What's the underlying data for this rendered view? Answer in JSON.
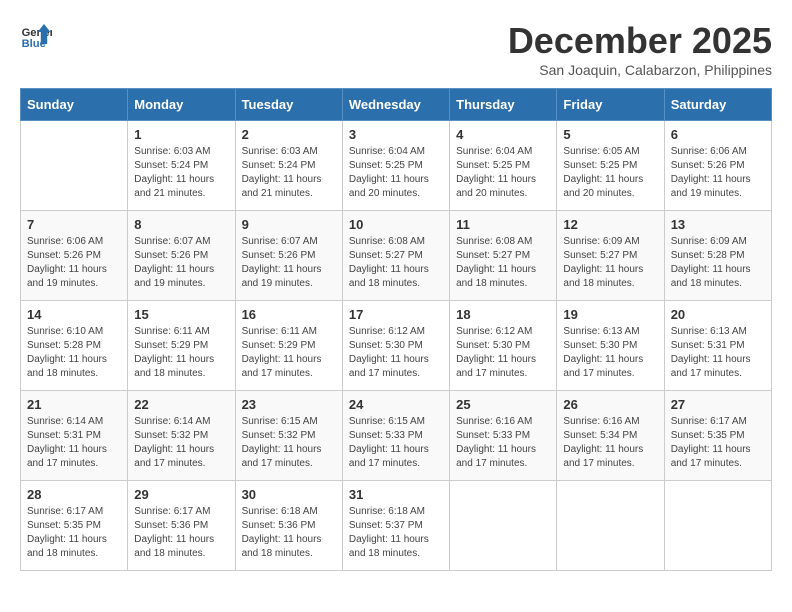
{
  "header": {
    "logo_line1": "General",
    "logo_line2": "Blue",
    "month": "December 2025",
    "location": "San Joaquin, Calabarzon, Philippines"
  },
  "weekdays": [
    "Sunday",
    "Monday",
    "Tuesday",
    "Wednesday",
    "Thursday",
    "Friday",
    "Saturday"
  ],
  "weeks": [
    [
      {
        "day": "",
        "sunrise": "",
        "sunset": "",
        "daylight": ""
      },
      {
        "day": "1",
        "sunrise": "Sunrise: 6:03 AM",
        "sunset": "Sunset: 5:24 PM",
        "daylight": "Daylight: 11 hours and 21 minutes."
      },
      {
        "day": "2",
        "sunrise": "Sunrise: 6:03 AM",
        "sunset": "Sunset: 5:24 PM",
        "daylight": "Daylight: 11 hours and 21 minutes."
      },
      {
        "day": "3",
        "sunrise": "Sunrise: 6:04 AM",
        "sunset": "Sunset: 5:25 PM",
        "daylight": "Daylight: 11 hours and 20 minutes."
      },
      {
        "day": "4",
        "sunrise": "Sunrise: 6:04 AM",
        "sunset": "Sunset: 5:25 PM",
        "daylight": "Daylight: 11 hours and 20 minutes."
      },
      {
        "day": "5",
        "sunrise": "Sunrise: 6:05 AM",
        "sunset": "Sunset: 5:25 PM",
        "daylight": "Daylight: 11 hours and 20 minutes."
      },
      {
        "day": "6",
        "sunrise": "Sunrise: 6:06 AM",
        "sunset": "Sunset: 5:26 PM",
        "daylight": "Daylight: 11 hours and 19 minutes."
      }
    ],
    [
      {
        "day": "7",
        "sunrise": "Sunrise: 6:06 AM",
        "sunset": "Sunset: 5:26 PM",
        "daylight": "Daylight: 11 hours and 19 minutes."
      },
      {
        "day": "8",
        "sunrise": "Sunrise: 6:07 AM",
        "sunset": "Sunset: 5:26 PM",
        "daylight": "Daylight: 11 hours and 19 minutes."
      },
      {
        "day": "9",
        "sunrise": "Sunrise: 6:07 AM",
        "sunset": "Sunset: 5:26 PM",
        "daylight": "Daylight: 11 hours and 19 minutes."
      },
      {
        "day": "10",
        "sunrise": "Sunrise: 6:08 AM",
        "sunset": "Sunset: 5:27 PM",
        "daylight": "Daylight: 11 hours and 18 minutes."
      },
      {
        "day": "11",
        "sunrise": "Sunrise: 6:08 AM",
        "sunset": "Sunset: 5:27 PM",
        "daylight": "Daylight: 11 hours and 18 minutes."
      },
      {
        "day": "12",
        "sunrise": "Sunrise: 6:09 AM",
        "sunset": "Sunset: 5:27 PM",
        "daylight": "Daylight: 11 hours and 18 minutes."
      },
      {
        "day": "13",
        "sunrise": "Sunrise: 6:09 AM",
        "sunset": "Sunset: 5:28 PM",
        "daylight": "Daylight: 11 hours and 18 minutes."
      }
    ],
    [
      {
        "day": "14",
        "sunrise": "Sunrise: 6:10 AM",
        "sunset": "Sunset: 5:28 PM",
        "daylight": "Daylight: 11 hours and 18 minutes."
      },
      {
        "day": "15",
        "sunrise": "Sunrise: 6:11 AM",
        "sunset": "Sunset: 5:29 PM",
        "daylight": "Daylight: 11 hours and 18 minutes."
      },
      {
        "day": "16",
        "sunrise": "Sunrise: 6:11 AM",
        "sunset": "Sunset: 5:29 PM",
        "daylight": "Daylight: 11 hours and 17 minutes."
      },
      {
        "day": "17",
        "sunrise": "Sunrise: 6:12 AM",
        "sunset": "Sunset: 5:30 PM",
        "daylight": "Daylight: 11 hours and 17 minutes."
      },
      {
        "day": "18",
        "sunrise": "Sunrise: 6:12 AM",
        "sunset": "Sunset: 5:30 PM",
        "daylight": "Daylight: 11 hours and 17 minutes."
      },
      {
        "day": "19",
        "sunrise": "Sunrise: 6:13 AM",
        "sunset": "Sunset: 5:30 PM",
        "daylight": "Daylight: 11 hours and 17 minutes."
      },
      {
        "day": "20",
        "sunrise": "Sunrise: 6:13 AM",
        "sunset": "Sunset: 5:31 PM",
        "daylight": "Daylight: 11 hours and 17 minutes."
      }
    ],
    [
      {
        "day": "21",
        "sunrise": "Sunrise: 6:14 AM",
        "sunset": "Sunset: 5:31 PM",
        "daylight": "Daylight: 11 hours and 17 minutes."
      },
      {
        "day": "22",
        "sunrise": "Sunrise: 6:14 AM",
        "sunset": "Sunset: 5:32 PM",
        "daylight": "Daylight: 11 hours and 17 minutes."
      },
      {
        "day": "23",
        "sunrise": "Sunrise: 6:15 AM",
        "sunset": "Sunset: 5:32 PM",
        "daylight": "Daylight: 11 hours and 17 minutes."
      },
      {
        "day": "24",
        "sunrise": "Sunrise: 6:15 AM",
        "sunset": "Sunset: 5:33 PM",
        "daylight": "Daylight: 11 hours and 17 minutes."
      },
      {
        "day": "25",
        "sunrise": "Sunrise: 6:16 AM",
        "sunset": "Sunset: 5:33 PM",
        "daylight": "Daylight: 11 hours and 17 minutes."
      },
      {
        "day": "26",
        "sunrise": "Sunrise: 6:16 AM",
        "sunset": "Sunset: 5:34 PM",
        "daylight": "Daylight: 11 hours and 17 minutes."
      },
      {
        "day": "27",
        "sunrise": "Sunrise: 6:17 AM",
        "sunset": "Sunset: 5:35 PM",
        "daylight": "Daylight: 11 hours and 17 minutes."
      }
    ],
    [
      {
        "day": "28",
        "sunrise": "Sunrise: 6:17 AM",
        "sunset": "Sunset: 5:35 PM",
        "daylight": "Daylight: 11 hours and 18 minutes."
      },
      {
        "day": "29",
        "sunrise": "Sunrise: 6:17 AM",
        "sunset": "Sunset: 5:36 PM",
        "daylight": "Daylight: 11 hours and 18 minutes."
      },
      {
        "day": "30",
        "sunrise": "Sunrise: 6:18 AM",
        "sunset": "Sunset: 5:36 PM",
        "daylight": "Daylight: 11 hours and 18 minutes."
      },
      {
        "day": "31",
        "sunrise": "Sunrise: 6:18 AM",
        "sunset": "Sunset: 5:37 PM",
        "daylight": "Daylight: 11 hours and 18 minutes."
      },
      {
        "day": "",
        "sunrise": "",
        "sunset": "",
        "daylight": ""
      },
      {
        "day": "",
        "sunrise": "",
        "sunset": "",
        "daylight": ""
      },
      {
        "day": "",
        "sunrise": "",
        "sunset": "",
        "daylight": ""
      }
    ]
  ]
}
